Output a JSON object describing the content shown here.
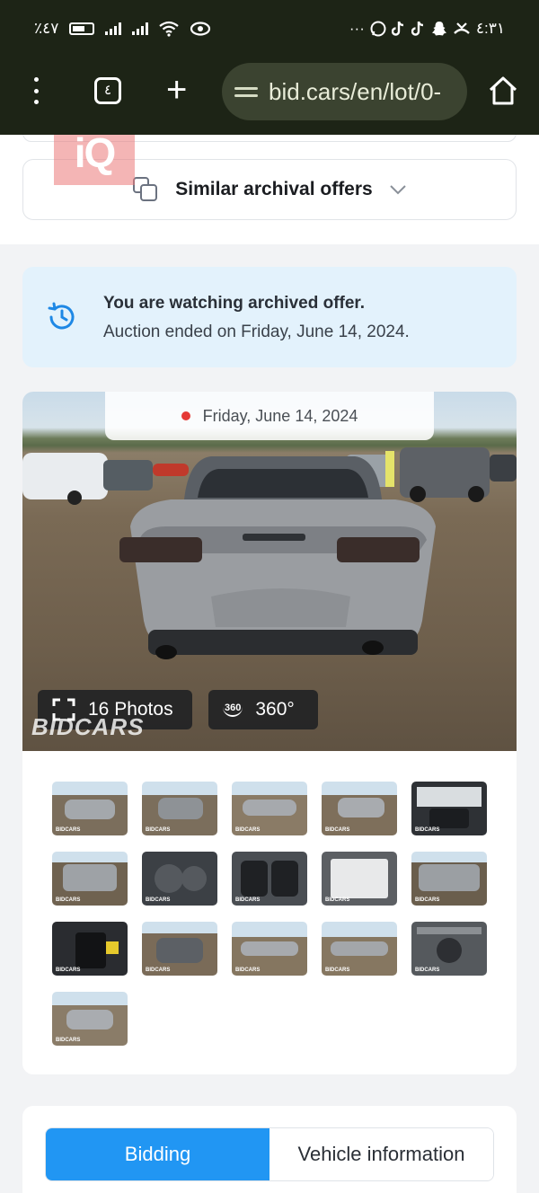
{
  "statusbar": {
    "battery": "٪٤٧",
    "time": "٤:٣١",
    "more": "···"
  },
  "browser": {
    "tab_count": "٤",
    "url": "bid.cars/en/lot/0-"
  },
  "similar": {
    "label": "Similar archival offers"
  },
  "notice": {
    "title": "You are watching archived offer.",
    "subtitle": "Auction ended on Friday, June 14, 2024."
  },
  "gallery": {
    "date": "Friday, June 14, 2024",
    "photos_label": "16 Photos",
    "view360_label": "360°",
    "badge360": "360",
    "watermark": "BIDCARS",
    "thumb_watermark": "BIDCARS"
  },
  "tabs": {
    "bidding": "Bidding",
    "vehicle_info": "Vehicle information"
  },
  "colors": {
    "accent": "#2196f3",
    "notice_bg": "#e3f2fc",
    "status_dot": "#e53935",
    "browser_bar": "#1d2416"
  }
}
